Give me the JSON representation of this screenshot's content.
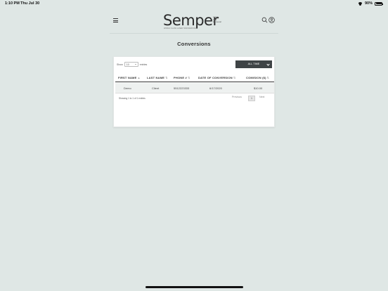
{
  "status_bar": {
    "time": "1:10 PM",
    "date": "Thu Jul 30",
    "battery": "90%"
  },
  "header": {
    "logo_word": "Semper",
    "logo_sub": [
      "Laser",
      "Hair",
      "Removal"
    ],
    "logo_tag": "WORLD CLASS LASER HAIR REMOVAL"
  },
  "page": {
    "title": "Conversions"
  },
  "table_controls": {
    "show_label": "Show",
    "entries_value": "10",
    "entries_label": "entries",
    "time_filter": "ALL TIME"
  },
  "table": {
    "columns": [
      "FIRST NAME",
      "LAST NAME",
      "PHONE #",
      "DATE OF CONVERSION",
      "COMISION ($)"
    ],
    "sort_first": "▲",
    "sort_other": "⇅",
    "rows": [
      [
        "Demo",
        "Client",
        "5512223333",
        "6/17/2020",
        "$10.00"
      ]
    ]
  },
  "footer": {
    "info": "Showing 1 to 1 of 1 entries",
    "previous": "Previous",
    "page": "1",
    "next": "Next"
  },
  "colors": {
    "background": "#dfe7e5",
    "filter_button": "#3f4446",
    "row_highlight": "#eef1f0"
  }
}
